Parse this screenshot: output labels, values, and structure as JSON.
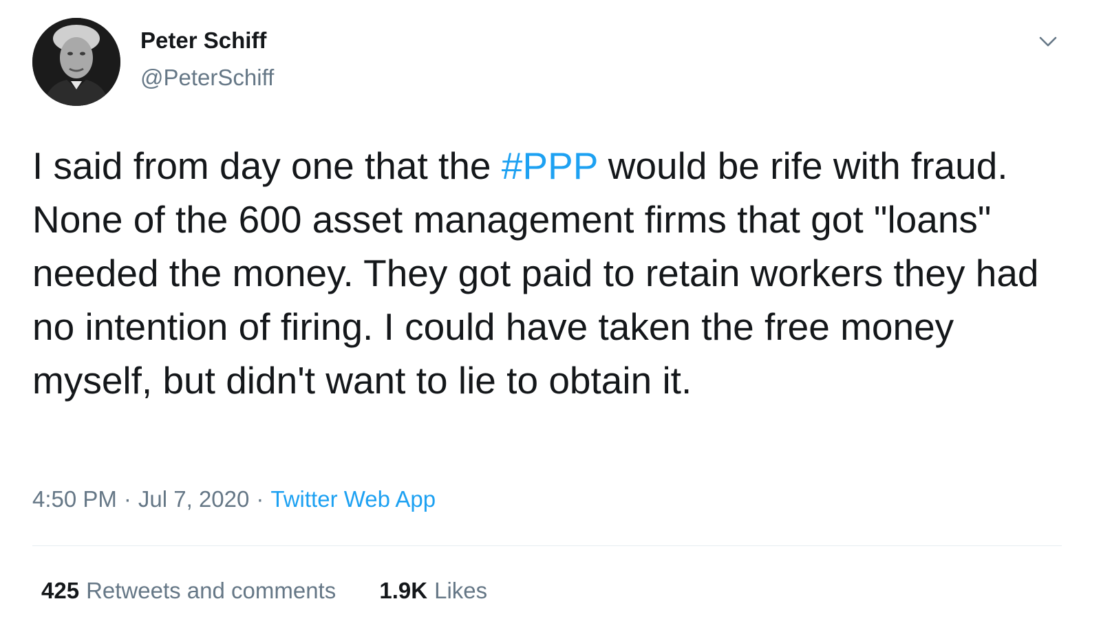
{
  "author": {
    "display_name": "Peter Schiff",
    "handle": "@PeterSchiff",
    "avatar_icon": "profile-photo"
  },
  "tweet": {
    "text_before_hashtag": "I said from day one that the ",
    "hashtag": "#PPP",
    "text_after_hashtag": " would be rife with fraud. None of the 600 asset management firms that got \"loans\" needed the money. They got paid to retain workers they had no intention of firing. I could have taken the free money myself, but didn't want to lie to obtain it."
  },
  "meta": {
    "time": "4:50 PM",
    "separator": "·",
    "date": "Jul 7, 2020",
    "source": "Twitter Web App"
  },
  "stats": {
    "retweets_count": "425",
    "retweets_label": "Retweets and comments",
    "likes_count": "1.9K",
    "likes_label": "Likes"
  },
  "colors": {
    "text": "#14171a",
    "secondary_text": "#657786",
    "link": "#1da1f2",
    "divider": "#e6ecf0"
  },
  "icons": {
    "menu": "chevron-down-icon"
  }
}
